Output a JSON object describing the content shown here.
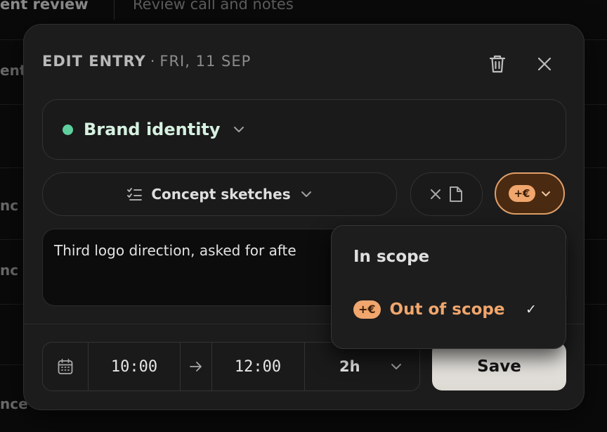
{
  "background": {
    "top_left_text": "ent review",
    "top_right_text": "Review call and notes",
    "fragments": [
      "ent",
      "nc",
      "nc",
      "nce"
    ]
  },
  "modal": {
    "title": "EDIT ENTRY",
    "separator": "·",
    "date": "FRI, 11 SEP",
    "project": {
      "label": "Brand identity",
      "color": "#5fcf9f"
    },
    "task": {
      "label": "Concept sketches"
    },
    "scope_badge": "+€",
    "notes": {
      "text": "Third logo direction, asked for afte"
    },
    "time": {
      "start": "10:00",
      "end": "12:00",
      "duration": "2h"
    },
    "save_label": "Save"
  },
  "scope_menu": {
    "options": [
      {
        "label": "In scope",
        "selected": false
      },
      {
        "label": "Out of scope",
        "badge": "+€",
        "selected": true
      }
    ],
    "check": "✓"
  }
}
